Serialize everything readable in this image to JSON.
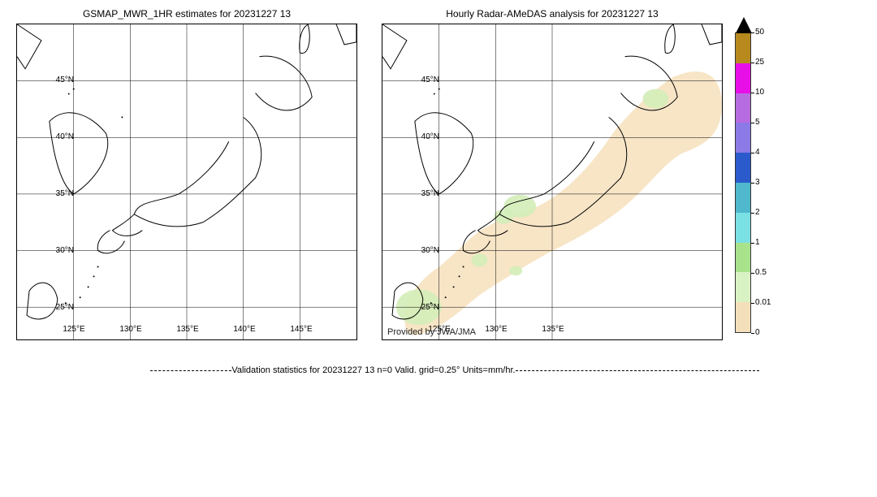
{
  "left": {
    "title": "GSMAP_MWR_1HR estimates for 20231227 13",
    "lat_ticks": [
      "45°N",
      "40°N",
      "35°N",
      "30°N",
      "25°N"
    ],
    "lon_ticks": [
      "125°E",
      "130°E",
      "135°E",
      "140°E",
      "145°E"
    ]
  },
  "right": {
    "title": "Hourly Radar-AMeDAS analysis for 20231227 13",
    "lat_ticks": [
      "45°N",
      "40°N",
      "35°N",
      "30°N",
      "25°N"
    ],
    "lon_ticks": [
      "125°E",
      "130°E",
      "135°E"
    ],
    "attribution": "Provided by JWA/JMA"
  },
  "colorbar": {
    "levels": [
      {
        "label": "50",
        "color": "#000000"
      },
      {
        "label": "25",
        "color": "#b88a1d"
      },
      {
        "label": "10",
        "color": "#e80ee8"
      },
      {
        "label": "5",
        "color": "#b76be0"
      },
      {
        "label": "4",
        "color": "#8c7ae6"
      },
      {
        "label": "3",
        "color": "#2a5acc"
      },
      {
        "label": "2",
        "color": "#4fb8cc"
      },
      {
        "label": "1",
        "color": "#7be0e3"
      },
      {
        "label": "0.5",
        "color": "#a8e38c"
      },
      {
        "label": "0.01",
        "color": "#d9f2c4"
      },
      {
        "label": "0",
        "color": "#f3dfba"
      }
    ]
  },
  "validation": "Validation statistics for 20231227 13  n=0 Valid. grid=0.25° Units=mm/hr.",
  "chart_data": {
    "type": "heatmap",
    "series": [
      {
        "name": "GSMAP_MWR_1HR estimates",
        "datetime_label": "20231227 13",
        "lon_range": [
          120,
          150
        ],
        "lat_range": [
          22,
          50
        ],
        "data_status": "no data / all zero (n=0)",
        "values": []
      },
      {
        "name": "Hourly Radar-AMeDAS analysis",
        "datetime_label": "20231227 13",
        "lon_range": [
          120,
          150
        ],
        "lat_range": [
          22,
          50
        ],
        "units": "mm/hr",
        "notes": "Coverage swath over Japan mostly 0–0.01 mm/hr (tan); small patches 0.01–0.5 mm/hr (pale green) near Okinawa/Taiwan area, western Honshu, and southern Hokkaido",
        "approx_patches": [
          {
            "region": "swath over Japan archipelago",
            "value_range": [
              0,
              0.01
            ]
          },
          {
            "region": "near 25N 122-124E (Taiwan/Yaeyama)",
            "value_range": [
              0.01,
              0.5
            ]
          },
          {
            "region": "near 34-36N 131-135E (western Honshu)",
            "value_range": [
              0.01,
              0.5
            ]
          },
          {
            "region": "near 42-44N 141-143E (Hokkaido)",
            "value_range": [
              0.01,
              0.5
            ]
          },
          {
            "region": "near 27-29N 128-131E (Amami/Okinawa)",
            "value_range": [
              0.01,
              0.5
            ]
          }
        ]
      }
    ],
    "colorbar_levels": [
      0,
      0.01,
      0.5,
      1,
      2,
      3,
      4,
      5,
      10,
      25,
      50
    ],
    "grid_resolution_deg": 0.25,
    "valid_point_count": 0
  }
}
